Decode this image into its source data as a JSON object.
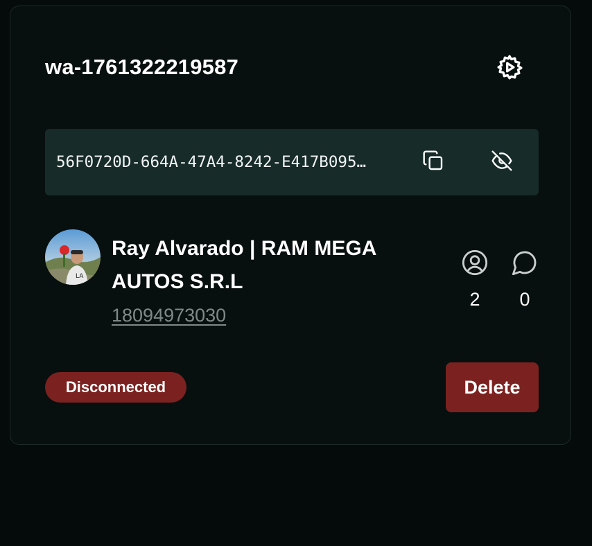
{
  "instance": {
    "name": "wa-1761322219587",
    "api_key": "56F0720D-664A-47A4-8242-E417B095…"
  },
  "profile": {
    "name": "Ray Alvarado | RAM MEGA AUTOS S.R.L",
    "phone": "18094973030"
  },
  "stats": {
    "contacts": "2",
    "chats": "0"
  },
  "status": {
    "label": "Disconnected",
    "color": "#7b2220"
  },
  "actions": {
    "delete_label": "Delete"
  },
  "icons": {
    "settings": "gear-icon",
    "copy": "copy-icon",
    "visibility": "eye-off-icon",
    "contacts": "user-circle-icon",
    "chats": "message-circle-icon"
  },
  "colors": {
    "background": "#050a0a",
    "card": "#080f0f",
    "key_box": "#172b29",
    "danger": "#7b2220",
    "muted_text": "#7f8a88"
  }
}
